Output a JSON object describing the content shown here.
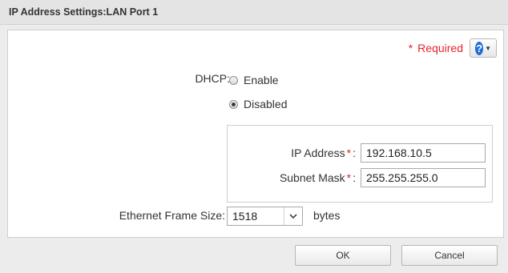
{
  "dialog": {
    "title": "IP Address Settings:LAN Port 1"
  },
  "required": {
    "star": "*",
    "label": "Required"
  },
  "help": {
    "glyph": "?",
    "icon": "help-circle-icon"
  },
  "dhcp": {
    "label": "DHCP:",
    "options": [
      {
        "label": "Enable",
        "checked": false
      },
      {
        "label": "Disabled",
        "checked": true
      }
    ]
  },
  "fields": {
    "ip_address": {
      "label": "IP Address",
      "star": "*",
      "colon": ":",
      "value": "192.168.10.5"
    },
    "subnet_mask": {
      "label": "Subnet Mask",
      "star": "*",
      "colon": ":",
      "value": "255.255.255.0"
    }
  },
  "ethernet": {
    "label": "Ethernet Frame Size:",
    "value": "1518",
    "unit": "bytes"
  },
  "buttons": {
    "ok": "OK",
    "cancel": "Cancel"
  },
  "colors": {
    "required": "#e8222b",
    "help": "#1f6fd6"
  }
}
